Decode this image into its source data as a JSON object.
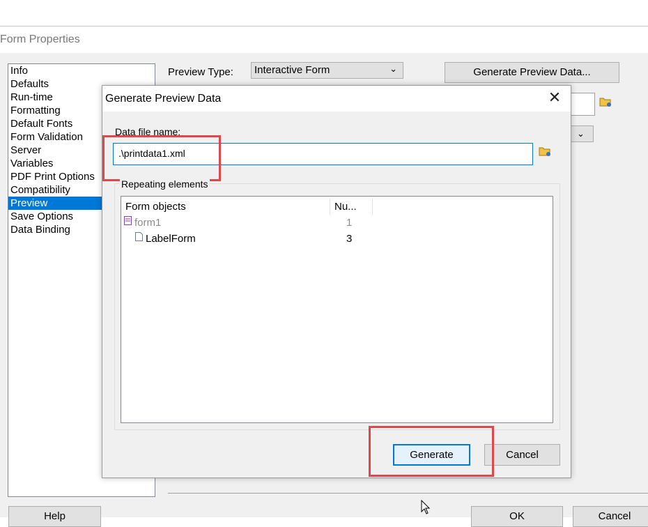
{
  "outer": {
    "title": "Form Properties",
    "categories": [
      "Info",
      "Defaults",
      "Run-time",
      "Formatting",
      "Default Fonts",
      "Form Validation",
      "Server",
      "Variables",
      "PDF Print Options",
      "Compatibility",
      "Preview",
      "Save Options",
      "Data Binding"
    ],
    "selected_category": "Preview",
    "preview_type_label": "Preview Type:",
    "preview_type_value": "Interactive Form",
    "generate_preview_button": "Generate Preview Data...",
    "help_button": "Help",
    "ok_button": "OK",
    "cancel_button": "Cancel"
  },
  "dialog": {
    "title": "Generate Preview Data",
    "data_file_label": "Data file name:",
    "data_file_value": ".\\printdata1.xml",
    "repeating_label": "Repeating elements",
    "columns": [
      "Form objects",
      "Nu..."
    ],
    "rows": [
      {
        "name": "form1",
        "num": "1"
      },
      {
        "name": "LabelForm",
        "num": "3"
      }
    ],
    "generate_button": "Generate",
    "cancel_button": "Cancel"
  },
  "colors": {
    "selection": "#0078d7",
    "highlight": "#e0464a"
  },
  "icons": [
    "folder-icon",
    "close-icon",
    "chevron-down-icon",
    "form-icon",
    "page-icon",
    "mouse-cursor-icon"
  ]
}
